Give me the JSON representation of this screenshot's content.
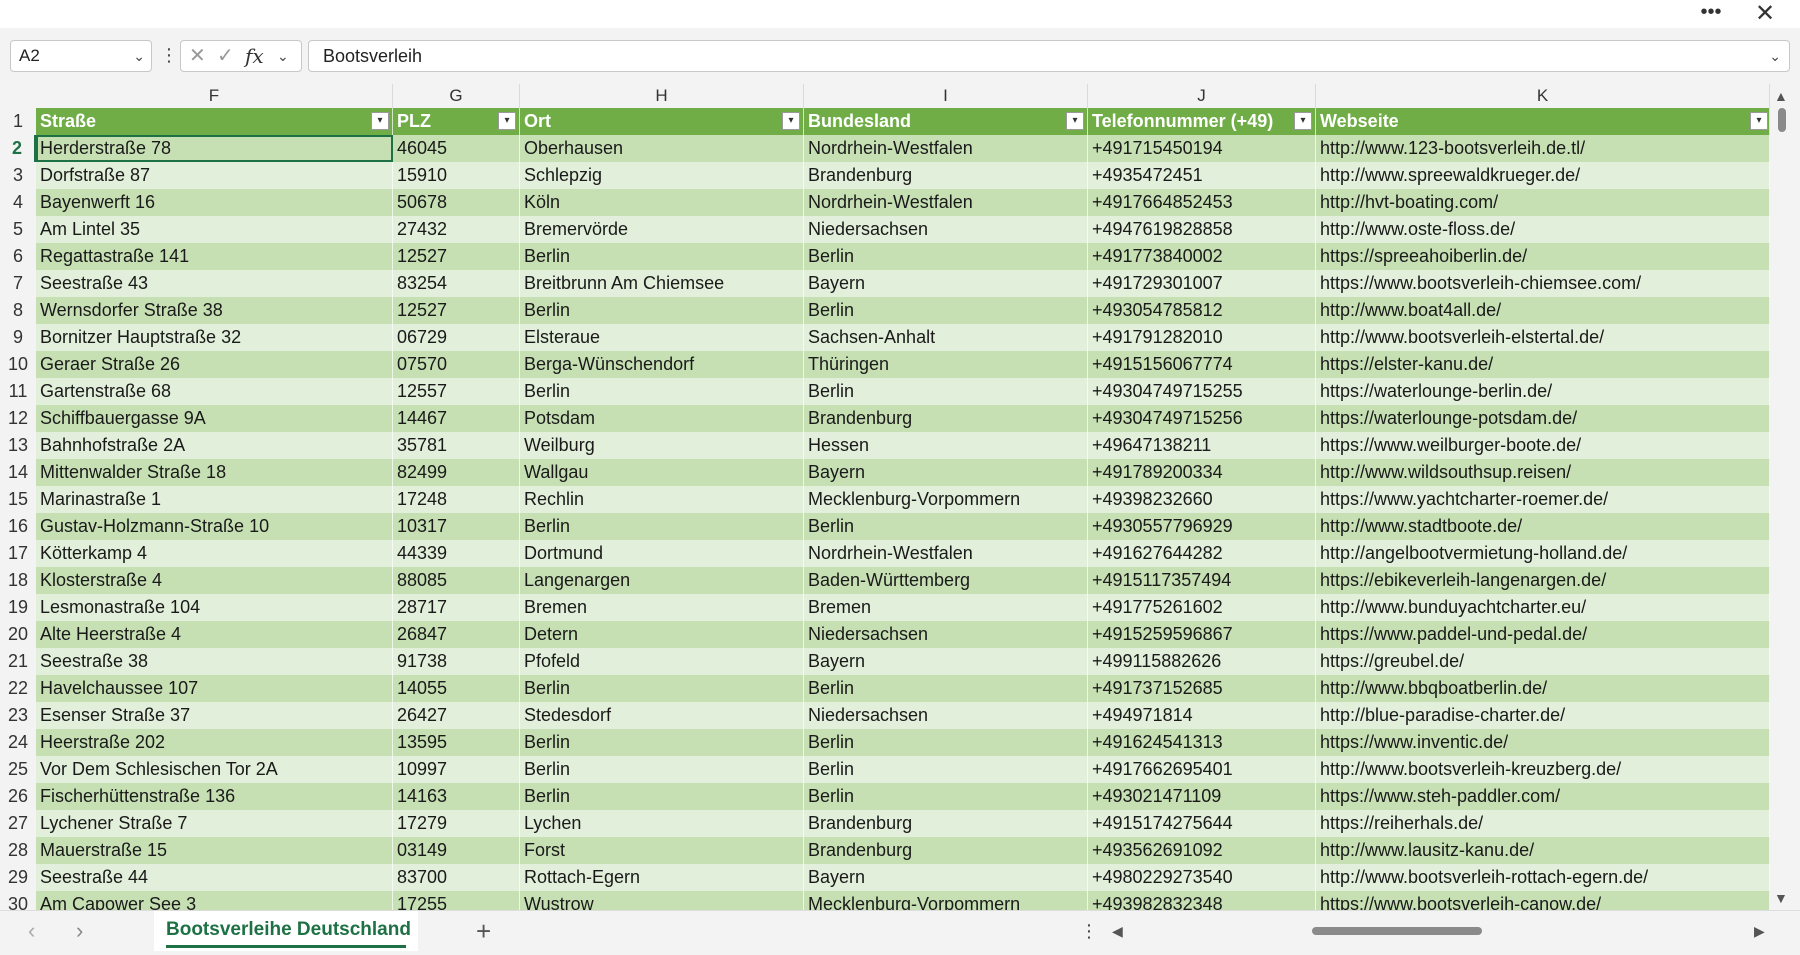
{
  "window": {
    "more_glyph": "•••",
    "close_glyph": "✕"
  },
  "formula_bar": {
    "name_box": "A2",
    "formula_value": "Bootsverleih",
    "cancel_glyph": "✕",
    "enter_glyph": "✓",
    "fx_glyph": "fx",
    "chevron_glyph": "⌄",
    "dots_glyph": "⋮"
  },
  "columns": [
    "F",
    "G",
    "H",
    "I",
    "J",
    "K"
  ],
  "header": [
    "Straße",
    "PLZ",
    "Ort",
    "Bundesland",
    "Telefonnummer (+49)",
    "Webseite"
  ],
  "filter_glyph": "▾",
  "rows": [
    {
      "num": "2",
      "cells": [
        "Herderstraße 78",
        "46045",
        "Oberhausen",
        "Nordrhein-Westfalen",
        "+491715450194",
        "http://www.123-bootsverleih.de.tl/"
      ]
    },
    {
      "num": "3",
      "cells": [
        "Dorfstraße 87",
        "15910",
        "Schlepzig",
        "Brandenburg",
        "+4935472451",
        "http://www.spreewaldkrueger.de/"
      ]
    },
    {
      "num": "4",
      "cells": [
        "Bayenwerft 16",
        "50678",
        "Köln",
        "Nordrhein-Westfalen",
        "+4917664852453",
        "http://hvt-boating.com/"
      ]
    },
    {
      "num": "5",
      "cells": [
        "Am Lintel 35",
        "27432",
        "Bremervörde",
        "Niedersachsen",
        "+494761982885 8",
        "http://www.oste-floss.de/"
      ]
    },
    {
      "num": "6",
      "cells": [
        "Regattastraße 141",
        "12527",
        "Berlin",
        "Berlin",
        "+491773840002",
        "https://spreeahoiberlin.de/"
      ]
    },
    {
      "num": "7",
      "cells": [
        "Seestraße 43",
        "83254",
        "Breitbrunn Am Chiemsee",
        "Bayern",
        "+491729301007",
        "https://www.bootsverleih-chiemsee.com/"
      ]
    },
    {
      "num": "8",
      "cells": [
        "Wernsdorfer Straße 38",
        "12527",
        "Berlin",
        "Berlin",
        "+493054785812",
        "http://www.boat4all.de/"
      ]
    },
    {
      "num": "9",
      "cells": [
        "Bornitzer Hauptstraße 32",
        "06729",
        "Elsteraue",
        "Sachsen-Anhalt",
        "+491791282010",
        "http://www.bootsverleih-elstertal.de/"
      ]
    },
    {
      "num": "10",
      "cells": [
        "Geraer Straße 26",
        "07570",
        "Berga-Wünschendorf",
        "Thüringen",
        "+4915156067774",
        "https://elster-kanu.de/"
      ]
    },
    {
      "num": "11",
      "cells": [
        "Gartenstraße 68",
        "12557",
        "Berlin",
        "Berlin",
        "+49304749715255",
        "https://waterlounge-berlin.de/"
      ]
    },
    {
      "num": "12",
      "cells": [
        "Schiffbauergasse 9A",
        "14467",
        "Potsdam",
        "Brandenburg",
        "+49304749715256",
        "https://waterlounge-potsdam.de/"
      ]
    },
    {
      "num": "13",
      "cells": [
        "Bahnhofstraße 2A",
        "35781",
        "Weilburg",
        "Hessen",
        "+49647138211",
        "https://www.weilburger-boote.de/"
      ]
    },
    {
      "num": "14",
      "cells": [
        "Mittenwalder Straße 18",
        "82499",
        "Wallgau",
        "Bayern",
        "+491789200334",
        "http://www.wildsouthsup.reisen/"
      ]
    },
    {
      "num": "15",
      "cells": [
        "Marinastraße 1",
        "17248",
        "Rechlin",
        "Mecklenburg-Vorpommern",
        "+49398232660",
        "https://www.yachtcharter-roemer.de/"
      ]
    },
    {
      "num": "16",
      "cells": [
        "Gustav-Holzmann-Straße 10",
        "10317",
        "Berlin",
        "Berlin",
        "+4930557796929",
        "http://www.stadtboote.de/"
      ]
    },
    {
      "num": "17",
      "cells": [
        "Kötterkamp 4",
        "44339",
        "Dortmund",
        "Nordrhein-Westfalen",
        "+491627644282",
        "http://angelbootvermietung-holland.de/"
      ]
    },
    {
      "num": "18",
      "cells": [
        "Klosterstraße 4",
        "88085",
        "Langenargen",
        "Baden-Württemberg",
        "+4915117357494",
        "https://ebikeverleih-langenargen.de/"
      ]
    },
    {
      "num": "19",
      "cells": [
        "Lesmonastraße 104",
        "28717",
        "Bremen",
        "Bremen",
        "+491775261602",
        "http://www.bunduyachtcharter.eu/"
      ]
    },
    {
      "num": "20",
      "cells": [
        "Alte Heerstraße 4",
        "26847",
        "Detern",
        "Niedersachsen",
        "+4915259596867",
        "https://www.paddel-und-pedal.de/"
      ]
    },
    {
      "num": "21",
      "cells": [
        "Seestraße 38",
        "91738",
        "Pfofeld",
        "Bayern",
        "+499115882626",
        "https://greubel.de/"
      ]
    },
    {
      "num": "22",
      "cells": [
        "Havelchaussee 107",
        "14055",
        "Berlin",
        "Berlin",
        "+491737152685",
        "http://www.bbqboatberlin.de/"
      ]
    },
    {
      "num": "23",
      "cells": [
        "Esenser Straße 37",
        "26427",
        "Stedesdorf",
        "Niedersachsen",
        "+494971814",
        "http://blue-paradise-charter.de/"
      ]
    },
    {
      "num": "24",
      "cells": [
        "Heerstraße 202",
        "13595",
        "Berlin",
        "Berlin",
        "+491624541313",
        "https://www.inventic.de/"
      ]
    },
    {
      "num": "25",
      "cells": [
        "Vor Dem Schlesischen Tor 2A",
        "10997",
        "Berlin",
        "Berlin",
        "+4917662695401",
        "http://www.bootsverleih-kreuzberg.de/"
      ]
    },
    {
      "num": "26",
      "cells": [
        "Fischerhüttenstraße 136",
        "14163",
        "Berlin",
        "Berlin",
        "+493021471109",
        "https://www.steh-paddler.com/"
      ]
    },
    {
      "num": "27",
      "cells": [
        "Lychener Straße 7",
        "17279",
        "Lychen",
        "Brandenburg",
        "+4915174275644",
        "https://reiherhals.de/"
      ]
    },
    {
      "num": "28",
      "cells": [
        "Mauerstraße 15",
        "03149",
        "Forst",
        "Brandenburg",
        "+493562691092",
        "http://www.lausitz-kanu.de/"
      ]
    },
    {
      "num": "29",
      "cells": [
        "Seestraße 44",
        "83700",
        "Rottach-Egern",
        "Bayern",
        "+4980229273540",
        "http://www.bootsverleih-rottach-egern.de/"
      ]
    },
    {
      "num": "30",
      "cells": [
        "Am Capower See 3",
        "17255",
        "Wustrow",
        "Mecklenburg-Vorpommern",
        "+493982832348",
        "https://www.bootsverleih-canow.de/"
      ]
    }
  ],
  "sheet_tabs": {
    "active": "Bootsverleihe Deutschland",
    "add_glyph": "+",
    "prev_glyph": "‹",
    "next_glyph": "›"
  },
  "scroll": {
    "up_glyph": "▲",
    "down_glyph": "▼",
    "left_glyph": "◀",
    "right_glyph": "▶",
    "dots_glyph": "⋮"
  },
  "colors": {
    "header_green": "#70ad47",
    "band_dark": "#c6e0b4",
    "band_light": "#e2efda",
    "selection": "#1e7145"
  }
}
